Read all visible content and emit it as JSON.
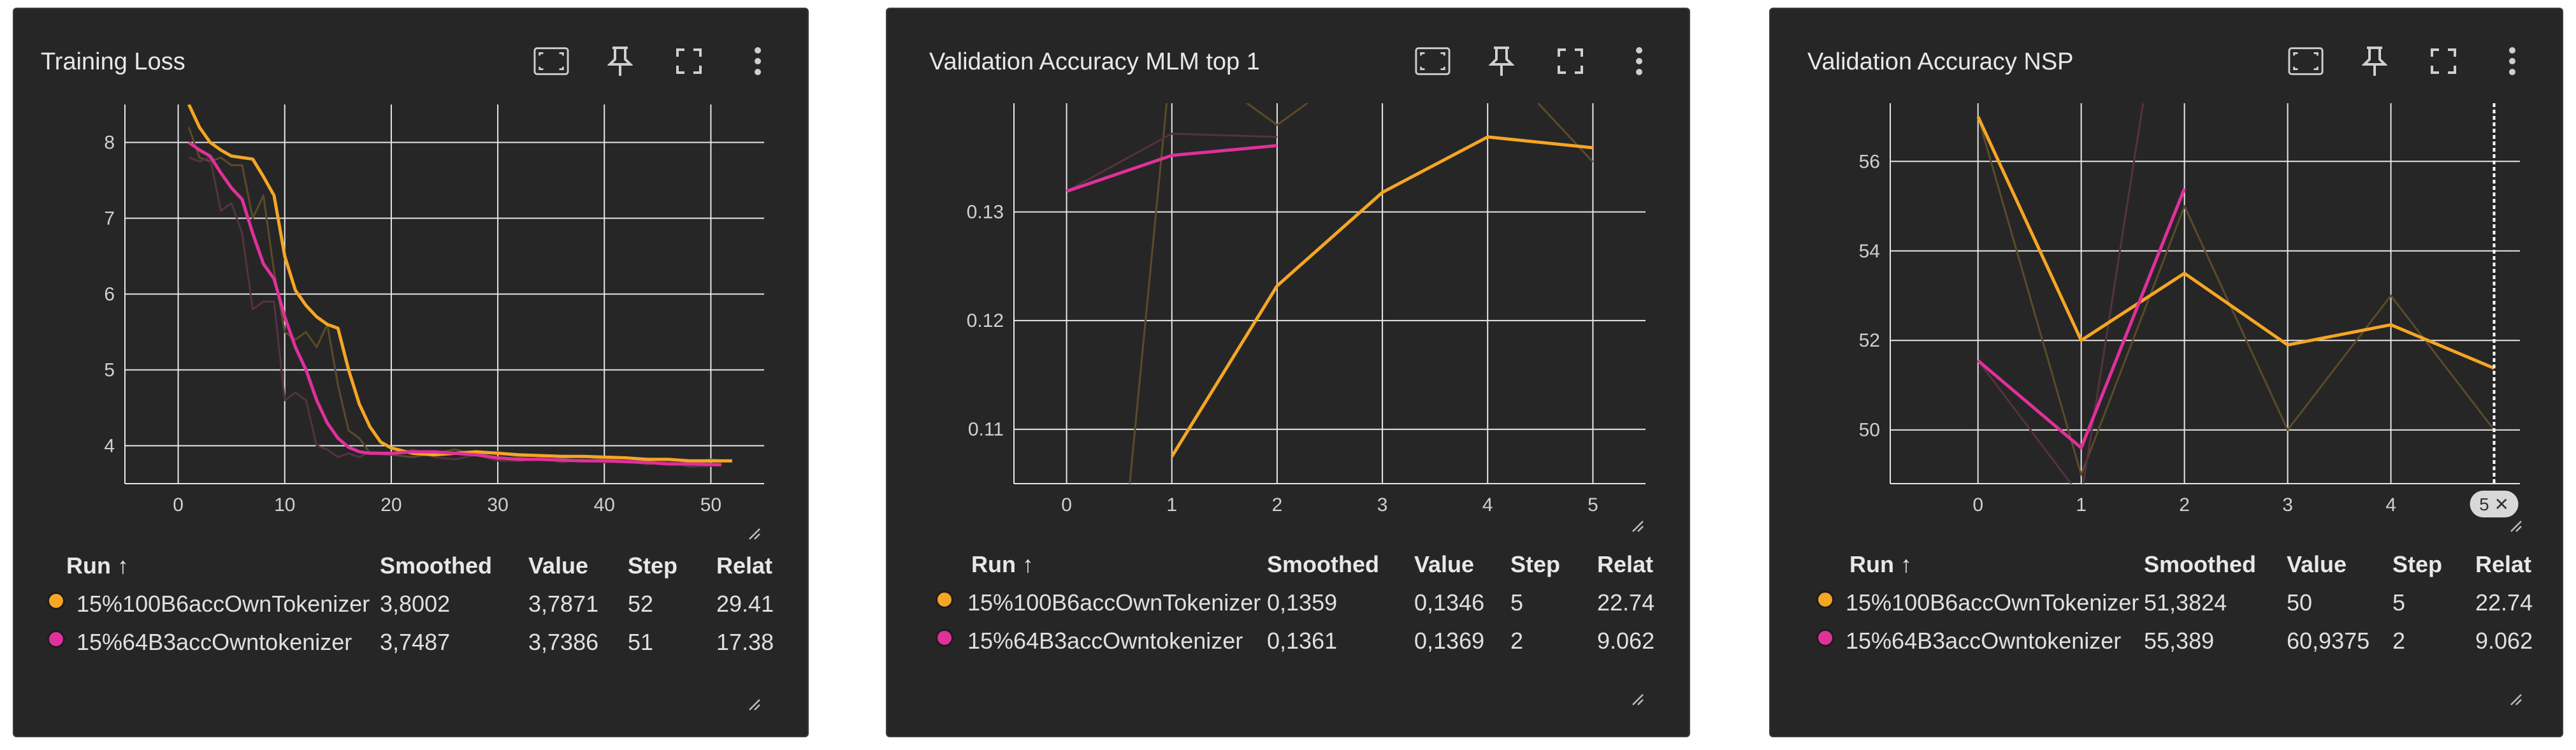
{
  "table_header": {
    "run": "Run ↑",
    "smoothed": "Smoothed",
    "value": "Value",
    "step": "Step",
    "relative": "Relat"
  },
  "colors": {
    "series1": "#f5a623",
    "series2": "#e0309a",
    "series1_raw": "#5b4a2a",
    "series2_raw": "#55323f",
    "grid": "#e6e6e6",
    "bg": "#262626"
  },
  "icons": [
    "fit-domain-icon",
    "pin-icon",
    "fullscreen-icon",
    "more-vert-icon"
  ],
  "cards": [
    {
      "title": "Training Loss",
      "rows": [
        {
          "run": "15%100B6accOwnTokenizer",
          "smoothed": "3,8002",
          "value": "3,7871",
          "step": "52",
          "relative": "29.41"
        },
        {
          "run": "15%64B3accOwntokenizer",
          "smoothed": "3,7487",
          "value": "3,7386",
          "step": "51",
          "relative": "17.38"
        }
      ]
    },
    {
      "title": "Validation Accuracy MLM top 1",
      "rows": [
        {
          "run": "15%100B6accOwnTokenizer",
          "smoothed": "0,1359",
          "value": "0,1346",
          "step": "5",
          "relative": "22.74"
        },
        {
          "run": "15%64B3accOwntokenizer",
          "smoothed": "0,1361",
          "value": "0,1369",
          "step": "2",
          "relative": "9.062"
        }
      ]
    },
    {
      "title": "Validation Accuracy NSP",
      "hover_badge": "5 ✕",
      "rows": [
        {
          "run": "15%100B6accOwnTokenizer",
          "smoothed": "51,3824",
          "value": "50",
          "step": "5",
          "relative": "22.74"
        },
        {
          "run": "15%64B3accOwntokenizer",
          "smoothed": "55,389",
          "value": "60,9375",
          "step": "2",
          "relative": "9.062"
        }
      ]
    }
  ],
  "chart_data": [
    {
      "type": "line",
      "title": "Training Loss",
      "xlabel": "",
      "ylabel": "",
      "xlim": [
        -5,
        55
      ],
      "ylim": [
        3.5,
        8.5
      ],
      "xticks": [
        0,
        10,
        20,
        30,
        40,
        50
      ],
      "yticks": [
        4,
        5,
        6,
        7,
        8
      ],
      "grid": true,
      "series": [
        {
          "name": "15%100B6accOwnTokenizer",
          "color": "#f5a623",
          "x": [
            1,
            2,
            3,
            4,
            5,
            6,
            7,
            8,
            9,
            10,
            11,
            12,
            13,
            14,
            15,
            16,
            17,
            18,
            19,
            20,
            22,
            24,
            26,
            28,
            30,
            32,
            34,
            36,
            38,
            40,
            42,
            44,
            46,
            48,
            50,
            52
          ],
          "y": [
            8.5,
            8.2,
            8.0,
            7.9,
            7.82,
            7.8,
            7.78,
            7.55,
            7.3,
            6.5,
            6.05,
            5.85,
            5.7,
            5.6,
            5.55,
            5.0,
            4.55,
            4.25,
            4.05,
            3.97,
            3.9,
            3.88,
            3.9,
            3.92,
            3.9,
            3.88,
            3.87,
            3.86,
            3.86,
            3.85,
            3.84,
            3.82,
            3.82,
            3.8,
            3.8,
            3.8
          ]
        },
        {
          "name": "15%64B3accOwntokenizer",
          "color": "#e0309a",
          "x": [
            1,
            2,
            3,
            4,
            5,
            6,
            7,
            8,
            9,
            10,
            11,
            12,
            13,
            14,
            15,
            16,
            17,
            18,
            19,
            20,
            22,
            24,
            26,
            28,
            30,
            32,
            34,
            36,
            38,
            40,
            42,
            44,
            46,
            48,
            51
          ],
          "y": [
            8.0,
            7.9,
            7.82,
            7.6,
            7.4,
            7.25,
            6.8,
            6.4,
            6.2,
            5.7,
            5.3,
            5.0,
            4.6,
            4.3,
            4.1,
            3.98,
            3.92,
            3.9,
            3.9,
            3.9,
            3.92,
            3.92,
            3.9,
            3.88,
            3.84,
            3.82,
            3.82,
            3.81,
            3.8,
            3.8,
            3.79,
            3.78,
            3.76,
            3.76,
            3.75
          ]
        },
        {
          "name": "",
          "color": "#5b4a2a",
          "raw": true,
          "x": [
            1,
            2,
            3,
            4,
            5,
            6,
            7,
            8,
            9,
            10,
            11,
            12,
            13,
            14,
            15,
            16,
            17,
            18,
            20,
            22,
            24,
            26,
            28,
            30,
            32,
            34,
            36,
            38,
            40,
            42,
            44,
            46,
            48,
            50,
            52
          ],
          "y": [
            8.2,
            7.8,
            7.75,
            7.8,
            7.7,
            7.7,
            7.0,
            7.3,
            6.3,
            5.5,
            5.4,
            5.5,
            5.3,
            5.6,
            4.8,
            4.2,
            4.1,
            3.9,
            3.88,
            3.85,
            3.9,
            3.95,
            3.88,
            3.92,
            3.85,
            3.88,
            3.84,
            3.86,
            3.82,
            3.84,
            3.8,
            3.82,
            3.78,
            3.82,
            3.79
          ]
        },
        {
          "name": "",
          "color": "#55323f",
          "raw": true,
          "x": [
            1,
            2,
            3,
            4,
            5,
            6,
            7,
            8,
            9,
            10,
            11,
            12,
            13,
            14,
            15,
            16,
            17,
            18,
            20,
            22,
            24,
            26,
            28,
            30,
            32,
            34,
            36,
            38,
            40,
            42,
            44,
            46,
            48,
            51
          ],
          "y": [
            7.8,
            7.75,
            7.8,
            7.1,
            7.2,
            6.8,
            5.8,
            5.9,
            5.9,
            4.6,
            4.7,
            4.6,
            4.0,
            3.95,
            3.85,
            3.9,
            3.85,
            3.92,
            3.9,
            3.95,
            3.85,
            3.82,
            3.88,
            3.8,
            3.8,
            3.84,
            3.78,
            3.82,
            3.78,
            3.8,
            3.75,
            3.8,
            3.72,
            3.74
          ]
        }
      ]
    },
    {
      "type": "line",
      "title": "Validation Accuracy MLM top 1",
      "xlabel": "",
      "ylabel": "",
      "xlim": [
        -0.5,
        5.5
      ],
      "ylim": [
        0.105,
        0.14
      ],
      "xticks": [
        0,
        1,
        2,
        3,
        4,
        5
      ],
      "yticks": [
        0.11,
        0.12,
        0.13
      ],
      "ytick_labels": [
        "0.11",
        "0.12",
        "0.13"
      ],
      "grid": true,
      "series": [
        {
          "name": "15%100B6accOwnTokenizer",
          "color": "#f5a623",
          "x": [
            1,
            2,
            3,
            4,
            5
          ],
          "y": [
            0.1075,
            0.1232,
            0.1318,
            0.1369,
            0.1359
          ]
        },
        {
          "name": "15%64B3accOwntokenizer",
          "color": "#e0309a",
          "x": [
            0,
            1,
            2
          ],
          "y": [
            0.1319,
            0.1352,
            0.1361
          ]
        },
        {
          "name": "",
          "color": "#5b4a2a",
          "raw": true,
          "x": [
            0.6,
            1,
            2,
            3,
            4,
            5
          ],
          "y": [
            0.105,
            0.145,
            0.138,
            0.145,
            0.145,
            0.1346
          ]
        },
        {
          "name": "",
          "color": "#55323f",
          "raw": true,
          "x": [
            0,
            1,
            2
          ],
          "y": [
            0.1319,
            0.1372,
            0.1369
          ]
        }
      ]
    },
    {
      "type": "line",
      "title": "Validation Accuracy NSP",
      "xlabel": "",
      "ylabel": "",
      "xlim": [
        -0.85,
        5.25
      ],
      "ylim": [
        48.8,
        57.3
      ],
      "xticks": [
        0,
        1,
        2,
        3,
        4
      ],
      "yticks": [
        50,
        52,
        54,
        56
      ],
      "grid": true,
      "series": [
        {
          "name": "15%100B6accOwnTokenizer",
          "color": "#f5a623",
          "x": [
            0,
            1,
            2,
            3,
            4,
            5
          ],
          "y": [
            57.0,
            52.0,
            53.5,
            51.9,
            52.35,
            51.38
          ]
        },
        {
          "name": "15%64B3accOwntokenizer",
          "color": "#e0309a",
          "x": [
            0,
            1,
            2
          ],
          "y": [
            51.55,
            49.6,
            55.39
          ]
        },
        {
          "name": "",
          "color": "#5b4a2a",
          "raw": true,
          "x": [
            0,
            1,
            2,
            3,
            4,
            5
          ],
          "y": [
            57.0,
            49.0,
            55.0,
            50.0,
            53.0,
            50.0
          ]
        },
        {
          "name": "",
          "color": "#55323f",
          "raw": true,
          "x": [
            0,
            1,
            1.6
          ],
          "y": [
            51.55,
            48.5,
            57.3
          ]
        }
      ]
    }
  ]
}
